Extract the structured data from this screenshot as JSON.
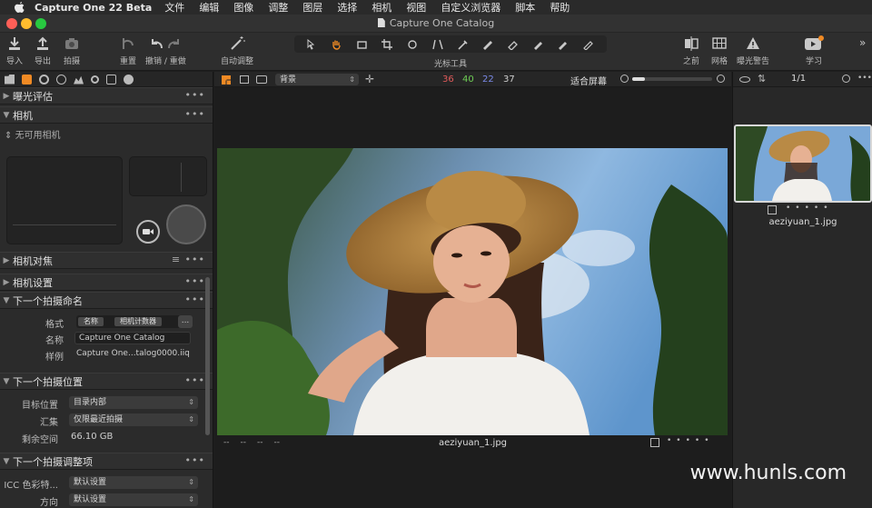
{
  "menubar": {
    "app": "Capture One 22 Beta",
    "items": [
      "文件",
      "编辑",
      "图像",
      "调整",
      "图层",
      "选择",
      "相机",
      "视图",
      "自定义浏览器",
      "脚本",
      "帮助"
    ]
  },
  "window": {
    "title": "Capture One Catalog"
  },
  "toolbar": {
    "import": "导入",
    "export": "导出",
    "capture": "拍摄",
    "reset": "重置",
    "undo_redo": "撤销 / 重做",
    "auto_adjust": "自动调整",
    "cursor_tools": "光标工具",
    "before": "之前",
    "grid": "网格",
    "exposure_warning": "曝光警告",
    "learn": "学习"
  },
  "left": {
    "exposure_eval": "曝光评估",
    "camera": "相机",
    "no_camera": "无可用相机",
    "camera_focus": "相机对焦",
    "camera_settings": "相机设置",
    "next_name": "下一个拍摄命名",
    "format_label": "格式",
    "format_tokens": [
      "名称",
      "相机计数器"
    ],
    "format_more": "...",
    "name_label": "名称",
    "name_value": "Capture One Catalog",
    "sample_label": "样例",
    "sample_value": "Capture One...talog0000.iiq",
    "next_location": "下一个拍摄位置",
    "dest_label": "目标位置",
    "dest_value": "目录内部",
    "collection_label": "汇集",
    "collection_value": "仅限最近拍摄",
    "space_label": "剩余空间",
    "space_value": "66.10 GB",
    "next_adjust": "下一个拍摄调整项",
    "icc_label": "ICC 色彩特...",
    "icc_value": "默认设置",
    "orient_label": "方向",
    "orient_value": "默认设置"
  },
  "viewer": {
    "background": "背景",
    "r": "36",
    "g": "40",
    "b": "22",
    "l": "37",
    "fit": "适合屏幕",
    "filename": "aeziyuan_1.jpg",
    "placeholders": [
      "--",
      "--",
      "--",
      "--"
    ]
  },
  "browser": {
    "count": "1/1",
    "thumb_name": "aeziyuan_1.jpg"
  },
  "watermark": "www.hunls.com",
  "colors": {
    "accent": "#f08a24",
    "red": "#e05a5a",
    "green": "#6fcf55",
    "blue": "#7a8ae8"
  }
}
